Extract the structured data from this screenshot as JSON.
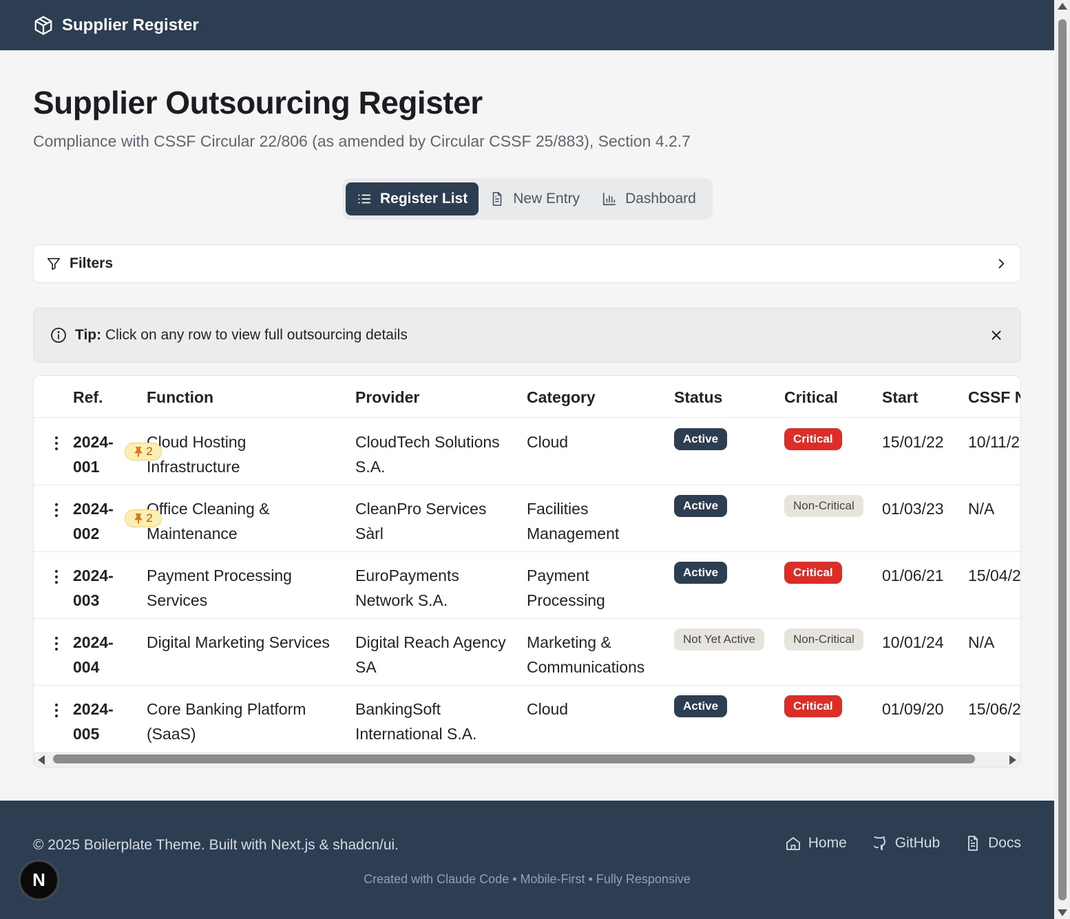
{
  "header": {
    "title": "Supplier Register",
    "logo_icon": "package-icon"
  },
  "page": {
    "title": "Supplier Outsourcing Register",
    "subtitle": "Compliance with CSSF Circular 22/806 (as amended by Circular CSSF 25/883), Section 4.2.7"
  },
  "tabs": [
    {
      "label": "Register List",
      "icon": "list-icon",
      "active": true
    },
    {
      "label": "New Entry",
      "icon": "file-icon",
      "active": false
    },
    {
      "label": "Dashboard",
      "icon": "bar-chart-icon",
      "active": false
    }
  ],
  "filters": {
    "label": "Filters"
  },
  "tip": {
    "prefix": "Tip:",
    "text": "Click on any row to view full outsourcing details"
  },
  "table": {
    "columns": [
      "Ref.",
      "Function",
      "Provider",
      "Category",
      "Status",
      "Critical",
      "Start",
      "CSSF N"
    ],
    "rows": [
      {
        "ref": [
          "2024-",
          "001"
        ],
        "function": [
          "Cloud Hosting",
          "Infrastructure"
        ],
        "provider": [
          "CloudTech Solutions",
          "S.A."
        ],
        "category": [
          "Cloud"
        ],
        "status": "Active",
        "critical": "Critical",
        "start": "15/01/22",
        "cssf": "10/11/2",
        "pins": "2"
      },
      {
        "ref": [
          "2024-",
          "002"
        ],
        "function": [
          "Office Cleaning &",
          "Maintenance"
        ],
        "provider": [
          "CleanPro Services",
          "Sàrl"
        ],
        "category": [
          "Facilities",
          "Management"
        ],
        "status": "Active",
        "critical": "Non-Critical",
        "start": "01/03/23",
        "cssf": "N/A",
        "pins": "2"
      },
      {
        "ref": [
          "2024-",
          "003"
        ],
        "function": [
          "Payment Processing",
          "Services"
        ],
        "provider": [
          "EuroPayments",
          "Network S.A."
        ],
        "category": [
          "Payment",
          "Processing"
        ],
        "status": "Active",
        "critical": "Critical",
        "start": "01/06/21",
        "cssf": "15/04/2",
        "pins": ""
      },
      {
        "ref": [
          "2024-",
          "004"
        ],
        "function": [
          "Digital Marketing Services"
        ],
        "provider": [
          "Digital Reach Agency",
          "SA"
        ],
        "category": [
          "Marketing &",
          "Communications"
        ],
        "status": "Not Yet Active",
        "critical": "Non-Critical",
        "start": "10/01/24",
        "cssf": "N/A",
        "pins": ""
      },
      {
        "ref": [
          "2024-",
          "005"
        ],
        "function": [
          "Core Banking Platform",
          "(SaaS)"
        ],
        "provider": [
          "BankingSoft",
          "International S.A."
        ],
        "category": [
          "Cloud"
        ],
        "status": "Active",
        "critical": "Critical",
        "start": "01/09/20",
        "cssf": "15/06/2",
        "pins": ""
      }
    ]
  },
  "footer": {
    "copyright": "© 2025 Boilerplate Theme. Built with Next.js & shadcn/ui.",
    "links": [
      {
        "label": "Home",
        "icon": "home-icon"
      },
      {
        "label": "GitHub",
        "icon": "github-icon"
      },
      {
        "label": "Docs",
        "icon": "document-icon"
      }
    ],
    "credits": "Created with Claude Code • Mobile-First • Fully Responsive"
  },
  "next_badge": {
    "letter": "N"
  },
  "colors": {
    "header_bg": "#2d3e53",
    "active_badge": "#2d3e53",
    "critical_badge": "#dc2d26",
    "non_critical_badge": "#e7e4de",
    "pin_badge": "#fdeeb4"
  }
}
